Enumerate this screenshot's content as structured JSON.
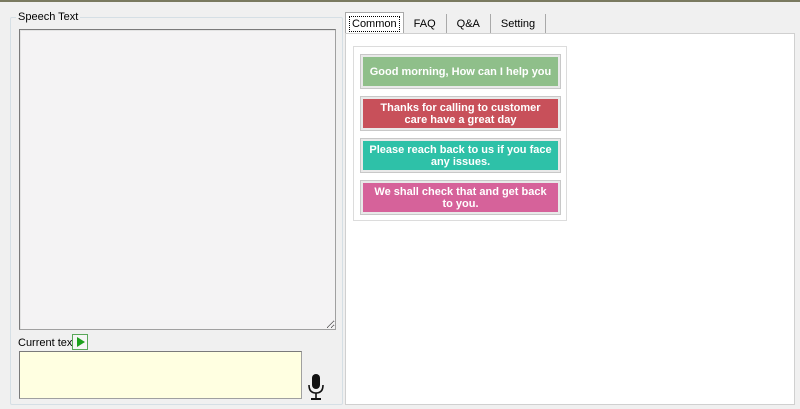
{
  "speech_group": {
    "title": "Speech Text",
    "speech_text_value": ""
  },
  "current": {
    "label": "Current text",
    "value": "",
    "play_icon": "play-icon",
    "mic_icon": "microphone-icon"
  },
  "tabs": [
    {
      "label": "Common",
      "active": true
    },
    {
      "label": "FAQ",
      "active": false
    },
    {
      "label": "Q&A",
      "active": false
    },
    {
      "label": "Setting",
      "active": false
    }
  ],
  "common_buttons": [
    {
      "label": "Good morning, How can I help you",
      "color": "#8fbf8a"
    },
    {
      "label": "Thanks for calling to customer care have a great day",
      "color": "#c8505a"
    },
    {
      "label": "Please reach back to us if you face any issues.",
      "color": "#2ec1a8"
    },
    {
      "label": "We shall check that and get back to you.",
      "color": "#d6629a"
    }
  ],
  "colors": {
    "current_text_bg": "#ffffe1",
    "speech_text_bg": "#f4f3f4",
    "play_green": "#1da11d"
  }
}
